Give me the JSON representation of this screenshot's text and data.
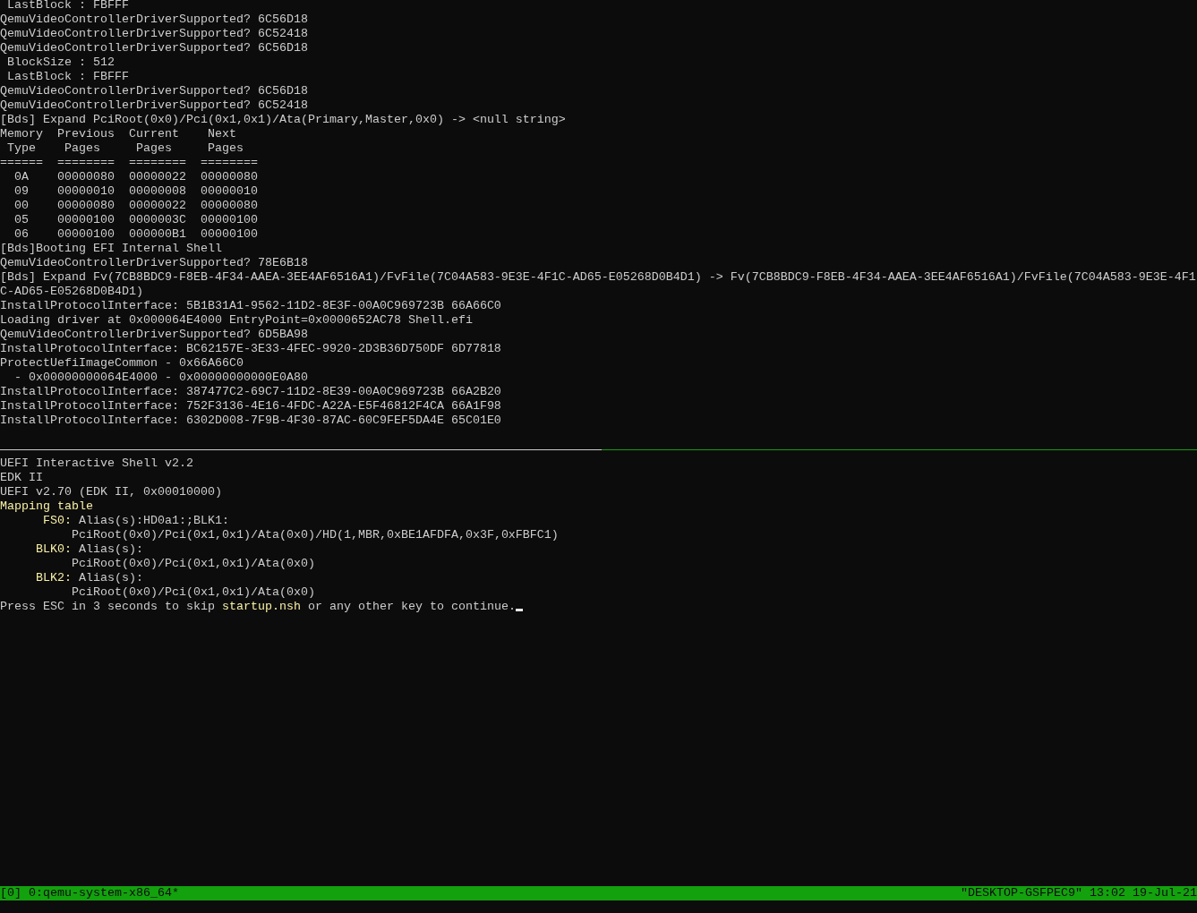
{
  "panes": [
    {
      "active": false,
      "lines": [
        " LastBlock : FBFFF",
        "QemuVideoControllerDriverSupported? 6C56D18",
        "QemuVideoControllerDriverSupported? 6C52418",
        "QemuVideoControllerDriverSupported? 6C56D18",
        " BlockSize : 512",
        " LastBlock : FBFFF",
        "QemuVideoControllerDriverSupported? 6C56D18",
        "QemuVideoControllerDriverSupported? 6C52418",
        "[Bds] Expand PciRoot(0x0)/Pci(0x1,0x1)/Ata(Primary,Master,0x0) -> <null string>",
        "Memory  Previous  Current    Next",
        " Type    Pages     Pages     Pages",
        "======  ========  ========  ========",
        "  0A    00000080  00000022  00000080",
        "  09    00000010  00000008  00000010",
        "  00    00000080  00000022  00000080",
        "  05    00000100  0000003C  00000100",
        "  06    00000100  000000B1  00000100",
        "[Bds]Booting EFI Internal Shell",
        "QemuVideoControllerDriverSupported? 78E6B18",
        "[Bds] Expand Fv(7CB8BDC9-F8EB-4F34-AAEA-3EE4AF6516A1)/FvFile(7C04A583-9E3E-4F1C-AD65-E05268D0B4D1) -> Fv(7CB8BDC9-F8EB-4F34-AAEA-3EE4AF6516A1)/FvFile(7C04A583-9E3E-4F1",
        "C-AD65-E05268D0B4D1)",
        "InstallProtocolInterface: 5B1B31A1-9562-11D2-8E3F-00A0C969723B 66A66C0",
        "Loading driver at 0x000064E4000 EntryPoint=0x0000652AC78 Shell.efi",
        "QemuVideoControllerDriverSupported? 6D5BA98",
        "InstallProtocolInterface: BC62157E-3E33-4FEC-9920-2D3B36D750DF 6D77818",
        "ProtectUefiImageCommon - 0x66A66C0",
        "  - 0x00000000064E4000 - 0x00000000000E0A80",
        "InstallProtocolInterface: 387477C2-69C7-11D2-8E39-00A0C969723B 66A2B20",
        "InstallProtocolInterface: 752F3136-4E16-4FDC-A22A-E5F46812F4CA 66A1F98",
        "InstallProtocolInterface: 6302D008-7F9B-4F30-87AC-60C9FEF5DA4E 65C01E0"
      ]
    },
    {
      "active": true,
      "lines": [
        "UEFI Interactive Shell v2.2",
        "EDK II",
        "UEFI v2.70 (EDK II, 0x00010000)",
        {
          "segments": [
            {
              "text": "Mapping table",
              "kind": "highlight"
            }
          ]
        },
        {
          "segments": [
            {
              "text": "      FS0:",
              "kind": "highlight"
            },
            {
              "text": " Alias(s):HD0a1:;BLK1:",
              "kind": "plain"
            }
          ]
        },
        "          PciRoot(0x0)/Pci(0x1,0x1)/Ata(0x0)/HD(1,MBR,0xBE1AFDFA,0x3F,0xFBFC1)",
        {
          "segments": [
            {
              "text": "     BLK0:",
              "kind": "highlight"
            },
            {
              "text": " Alias(s):",
              "kind": "plain"
            }
          ]
        },
        "          PciRoot(0x0)/Pci(0x1,0x1)/Ata(0x0)",
        {
          "segments": [
            {
              "text": "     BLK2:",
              "kind": "highlight"
            },
            {
              "text": " Alias(s):",
              "kind": "plain"
            }
          ]
        },
        "          PciRoot(0x0)/Pci(0x1,0x1)/Ata(0x0)",
        {
          "segments": [
            {
              "text": "Press ESC in 3 seconds to skip ",
              "kind": "plain"
            },
            {
              "text": "startup.nsh",
              "kind": "highlight"
            },
            {
              "text": " or any other key to continue.",
              "kind": "plain"
            }
          ]
        }
      ]
    }
  ],
  "status_bar": {
    "session": "[0]",
    "window": "0:qemu-system-x86_64*",
    "host": "\"DESKTOP-GSFPEC9\"",
    "time": "13:02",
    "date": "19-Jul-21"
  }
}
